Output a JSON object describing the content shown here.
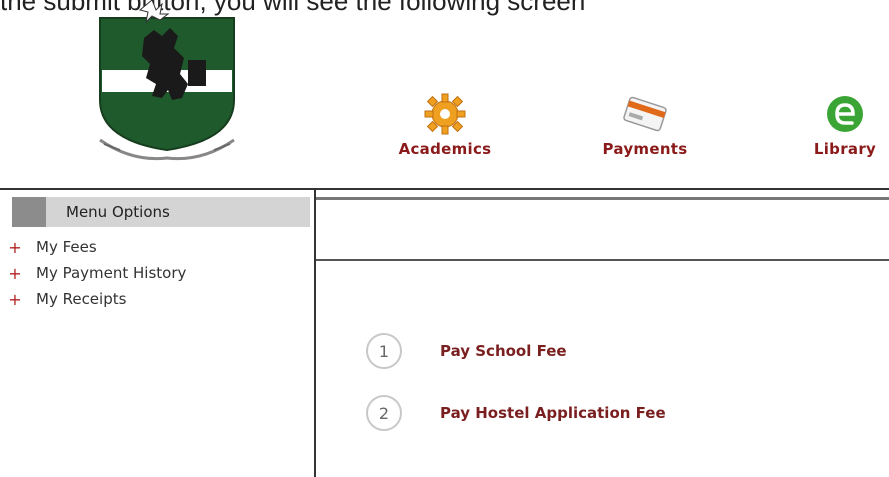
{
  "header": {
    "caption_fragment": "the submit button, you will see the following screen"
  },
  "logo": {
    "emblem": "crest-logo",
    "colors": {
      "shield": "#1f5a2c",
      "band": "#ffffff",
      "figure": "#1a1a1a"
    }
  },
  "nav": {
    "items": [
      {
        "label": "Academics",
        "icon": "gear-icon",
        "color": "#f0a020"
      },
      {
        "label": "Payments",
        "icon": "card-icon",
        "color": "#e06a1a"
      },
      {
        "label": "Library",
        "icon": "library-icon",
        "color": "#3aa534"
      }
    ]
  },
  "sidebar": {
    "header": "Menu Options",
    "items": [
      {
        "label": "My Fees"
      },
      {
        "label": "My Payment History"
      },
      {
        "label": "My Receipts"
      }
    ]
  },
  "main": {
    "options": [
      {
        "number": "1",
        "label": "Pay School Fee"
      },
      {
        "number": "2",
        "label": "Pay Hostel Application Fee"
      }
    ]
  }
}
